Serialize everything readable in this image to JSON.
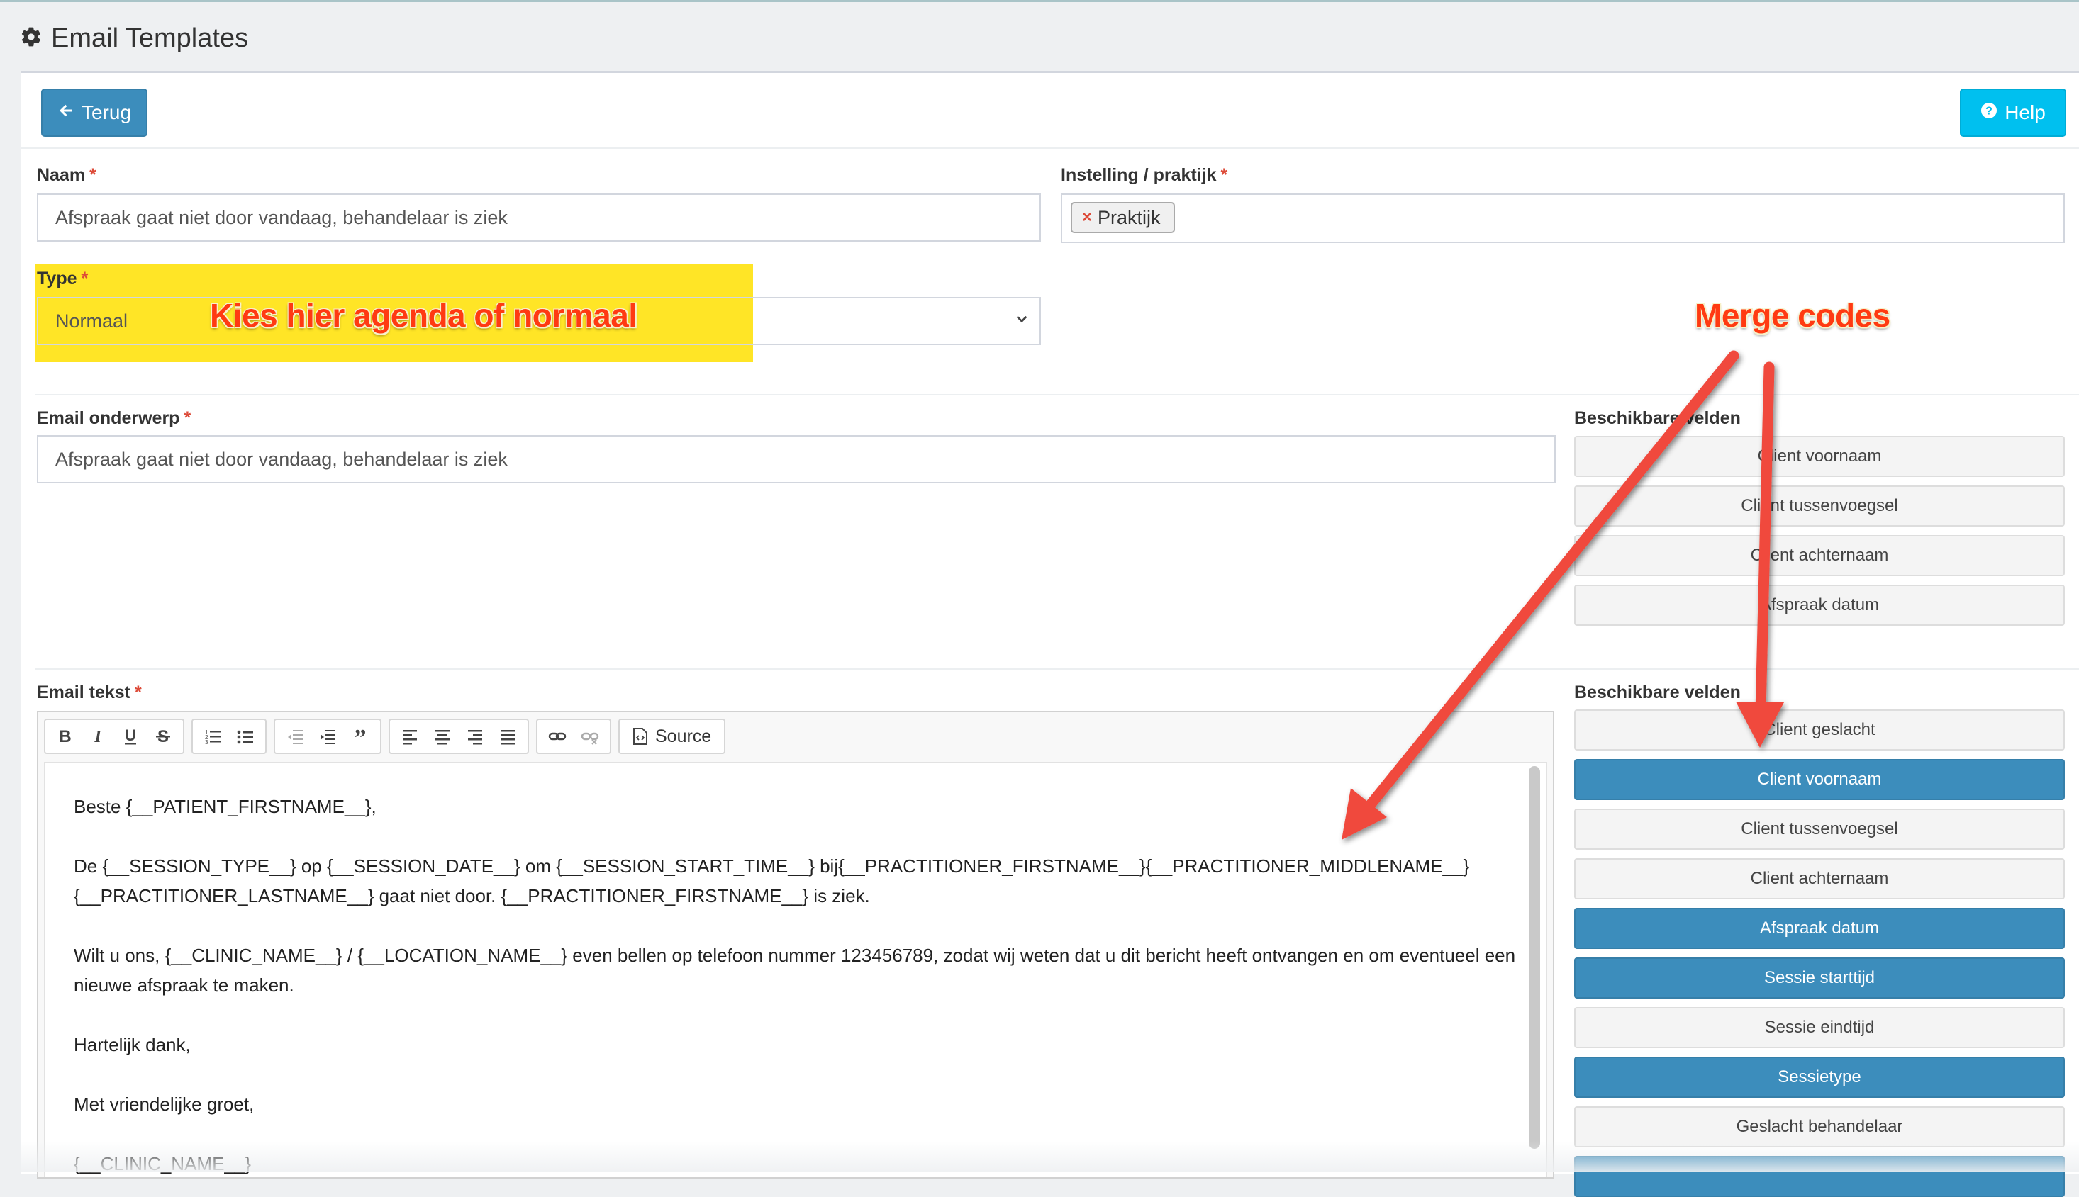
{
  "page": {
    "title": "Email Templates",
    "title_icon": "gear-icon"
  },
  "header": {
    "back_label": "Terug",
    "back_icon": "arrow-left-icon",
    "help_label": "Help",
    "help_icon": "question-circle-icon"
  },
  "form": {
    "name": {
      "label": "Naam",
      "required": "*",
      "value": "Afspraak gaat niet door vandaag, behandelaar is ziek"
    },
    "institution": {
      "label": "Instelling / praktijk",
      "required": "*",
      "tag": "Praktijk",
      "tag_remove": "×"
    },
    "type": {
      "label": "Type",
      "required": "*",
      "value": "Normaal"
    },
    "subject": {
      "label": "Email onderwerp",
      "required": "*",
      "value": "Afspraak gaat niet door vandaag, behandelaar is ziek"
    },
    "body": {
      "label": "Email tekst",
      "required": "*",
      "source_label": "Source",
      "paragraphs": [
        "Beste {__PATIENT_FIRSTNAME__},",
        "De {__SESSION_TYPE__} op {__SESSION_DATE__} om {__SESSION_START_TIME__} bij{__PRACTITIONER_FIRSTNAME__}{__PRACTITIONER_MIDDLENAME__} {__PRACTITIONER_LASTNAME__} gaat niet door. {__PRACTITIONER_FIRSTNAME__} is ziek.",
        "Wilt u ons, {__CLINIC_NAME__} / {__LOCATION_NAME__} even bellen op telefoon nummer 123456789, zodat wij weten dat u dit bericht heeft ontvangen en om eventueel een nieuwe afspraak te maken.",
        "Hartelijk dank,",
        "Met vriendelijke groet,",
        "{__CLINIC_NAME__}"
      ]
    }
  },
  "fields_subject": {
    "title": "Beschikbare velden",
    "items": [
      {
        "label": "Client voornaam",
        "active": false
      },
      {
        "label": "Client tussenvoegsel",
        "active": false
      },
      {
        "label": "Client achternaam",
        "active": false
      },
      {
        "label": "Afspraak datum",
        "active": false
      }
    ]
  },
  "fields_body": {
    "title": "Beschikbare velden",
    "items": [
      {
        "label": "Client geslacht",
        "active": false
      },
      {
        "label": "Client voornaam",
        "active": true
      },
      {
        "label": "Client tussenvoegsel",
        "active": false
      },
      {
        "label": "Client achternaam",
        "active": false
      },
      {
        "label": "Afspraak datum",
        "active": true
      },
      {
        "label": "Sessie starttijd",
        "active": true
      },
      {
        "label": "Sessie eindtijd",
        "active": false
      },
      {
        "label": "Sessietype",
        "active": true
      },
      {
        "label": "Geslacht behandelaar",
        "active": false
      },
      {
        "label": "",
        "active": true
      }
    ]
  },
  "annotations": {
    "type_hint": "Kies hier agenda of normaal",
    "merge_codes": "Merge codes"
  },
  "colors": {
    "primary": "#3c8dbc",
    "info": "#00c0ef",
    "required": "#dd4b39",
    "highlight": "#ffe100",
    "annotation": "#ff3a12"
  }
}
